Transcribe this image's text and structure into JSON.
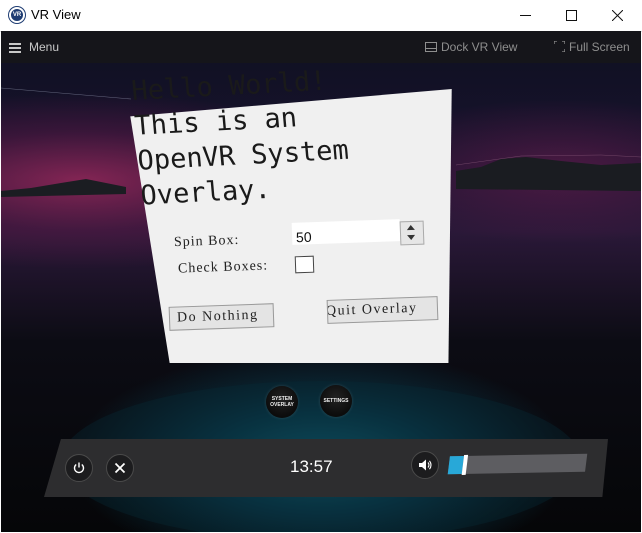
{
  "window": {
    "title": "VR View",
    "icon": "vr-app-icon",
    "icon_text": "VR",
    "controls": [
      "minimize-icon",
      "maximize-icon",
      "close-icon"
    ]
  },
  "menubar": {
    "menu_label": "Menu",
    "dock_label": "Dock VR View",
    "fullscreen_label": "Full Screen"
  },
  "overlay": {
    "heading_lines": [
      "Hello World!",
      "This is an",
      "OpenVR System",
      "Overlay."
    ],
    "spin_label": "Spin Box:",
    "spin_value": "50",
    "check_label": "Check Boxes:",
    "checkbox_checked": false,
    "button_do_nothing": "Do Nothing",
    "button_quit": "Quit Overlay"
  },
  "quick_buttons": [
    {
      "label": "SYSTEMOVERLAY"
    },
    {
      "label": "SETTINGS"
    }
  ],
  "dashboard": {
    "time": "13:57",
    "volume_level": 0.1,
    "colors": {
      "volume_fill": "#28a8d8",
      "bar": "#2d2d2f"
    }
  }
}
